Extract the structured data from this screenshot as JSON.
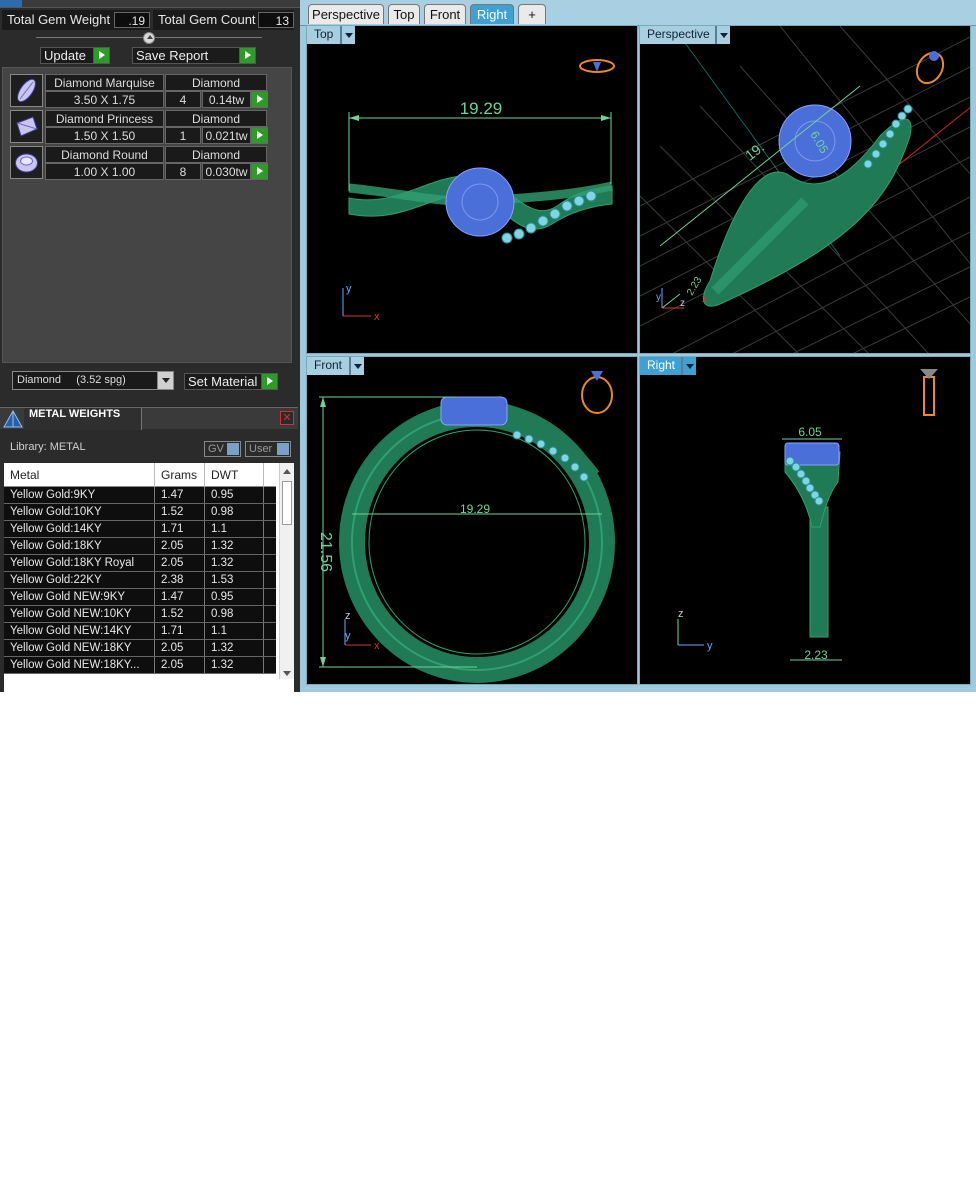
{
  "summary": {
    "gem_weight_label": "Total Gem Weight",
    "gem_weight_value": ".19",
    "gem_count_label": "Total Gem Count",
    "gem_count_value": "13"
  },
  "actions": {
    "update_label": "Update",
    "save_report_label": "Save Report"
  },
  "gems": [
    {
      "name": "Diamond Marquise",
      "type": "Diamond",
      "size": "3.50 X 1.75",
      "count": "4",
      "weight": "0.14tw",
      "icon": "marquise-gem-icon"
    },
    {
      "name": "Diamond Princess",
      "type": "Diamond",
      "size": "1.50 X 1.50",
      "count": "1",
      "weight": "0.021tw",
      "icon": "princess-gem-icon"
    },
    {
      "name": "Diamond Round",
      "type": "Diamond",
      "size": "1.00 X 1.00",
      "count": "8",
      "weight": "0.030tw",
      "icon": "round-gem-icon"
    }
  ],
  "material": {
    "selected": "Diamond     (3.52 spg)",
    "set_label": "Set Material"
  },
  "metal_weights": {
    "title": "METAL WEIGHTS",
    "library": "Library: METAL",
    "gv_label": "GV",
    "user_label": "User",
    "columns": [
      "Metal",
      "Grams",
      "DWT"
    ],
    "rows": [
      [
        "Yellow Gold:9KY",
        "1.47",
        "0.95"
      ],
      [
        "Yellow Gold:10KY",
        "1.52",
        "0.98"
      ],
      [
        "Yellow Gold:14KY",
        "1.71",
        "1.1"
      ],
      [
        "Yellow Gold:18KY",
        "2.05",
        "1.32"
      ],
      [
        "Yellow Gold:18KY Royal",
        "2.05",
        "1.32"
      ],
      [
        "Yellow Gold:22KY",
        "2.38",
        "1.53"
      ],
      [
        "Yellow Gold NEW:9KY",
        "1.47",
        "0.95"
      ],
      [
        "Yellow Gold NEW:10KY",
        "1.52",
        "0.98"
      ],
      [
        "Yellow Gold NEW:14KY",
        "1.71",
        "1.1"
      ],
      [
        "Yellow Gold NEW:18KY",
        "2.05",
        "1.32"
      ],
      [
        "Yellow Gold NEW:18KY...",
        "2.05",
        "1.32"
      ]
    ]
  },
  "view_tabs": [
    "Perspective",
    "Top",
    "Front",
    "Right",
    "+"
  ],
  "active_tab": "Right",
  "viewports": {
    "top": {
      "label": "Top",
      "dim": "19.29"
    },
    "perspective": {
      "label": "Perspective",
      "dim_a": "19.",
      "dim_b": "6.05",
      "dim_c": "2.23"
    },
    "front": {
      "label": "Front",
      "dim_w": "19.29",
      "dim_h": "21.56"
    },
    "right": {
      "label": "Right",
      "dim_top": "6.05",
      "dim_bottom": "2.23"
    }
  },
  "axes": {
    "x": "x",
    "y": "y",
    "z": "z"
  },
  "colors": {
    "ring": "#1f7a55",
    "gem": "#4b6fd8",
    "accent_gems": "#7fd6e0",
    "dimension": "#6fd39a",
    "active_tab": "#3fa0d4"
  }
}
